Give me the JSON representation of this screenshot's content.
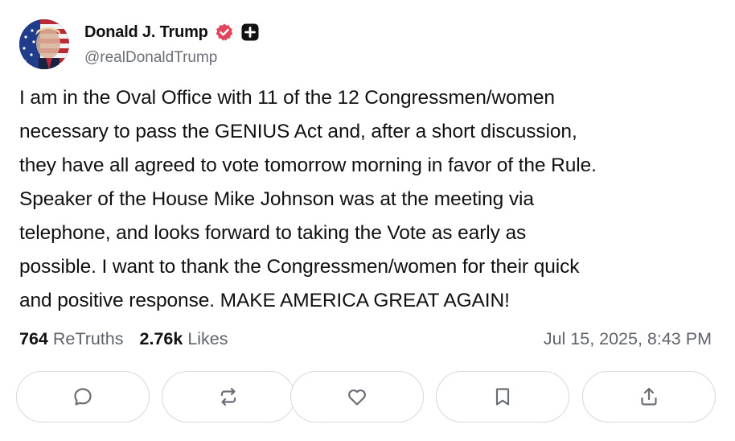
{
  "author": {
    "display_name": "Donald J. Trump",
    "handle": "@realDonaldTrump",
    "verified_icon": "verified-badge-icon",
    "badge_icon": "plus-badge-icon",
    "verified_color": "#e0475e"
  },
  "post": {
    "text": "I am in the Oval Office with 11 of the 12 Congressmen/women\nnecessary to pass the GENIUS Act and, after a short discussion,\nthey have all agreed to vote tomorrow morning in favor of the Rule.\nSpeaker of the House Mike Johnson was at the meeting via\ntelephone, and looks forward to taking the Vote as early as\npossible. I want to thank the Congressmen/women for their quick\nand positive response. MAKE AMERICA GREAT AGAIN!"
  },
  "stats": {
    "retruths_count": "764",
    "retruths_label": "ReTruths",
    "likes_count": "2.76k",
    "likes_label": "Likes",
    "timestamp": "Jul 15, 2025, 8:43 PM"
  },
  "actions": [
    {
      "icon": "comment-icon"
    },
    {
      "icon": "retruth-icon"
    },
    {
      "icon": "heart-icon"
    },
    {
      "icon": "bookmark-icon"
    },
    {
      "icon": "share-icon"
    }
  ]
}
